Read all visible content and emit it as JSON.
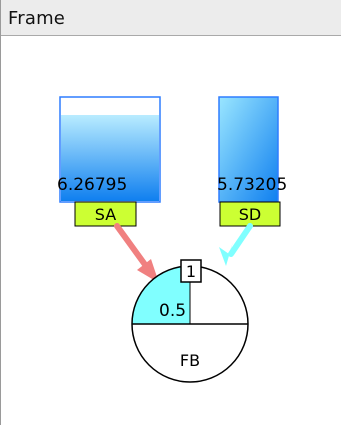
{
  "window": {
    "title": "Frame"
  },
  "diagram": {
    "colors": {
      "inflow_arrow": "#f08080",
      "outflow_arrow": "#80ffff",
      "label_fill": "#ccff33",
      "tank_fill_top": "#b9ecff",
      "tank_fill_bottom": "#0f7fef",
      "tank_border": "#2e7dff",
      "node_highlight": "#80ffff"
    },
    "stocks": [
      {
        "id": "SA",
        "label": "SA",
        "value": "6.26795",
        "fill_fraction": 0.83
      },
      {
        "id": "SD",
        "label": "SD",
        "value": "5.73205",
        "fill_fraction": 1.0
      }
    ],
    "flow_node": {
      "label": "FB",
      "value": "0.5",
      "port_label": "1"
    }
  }
}
